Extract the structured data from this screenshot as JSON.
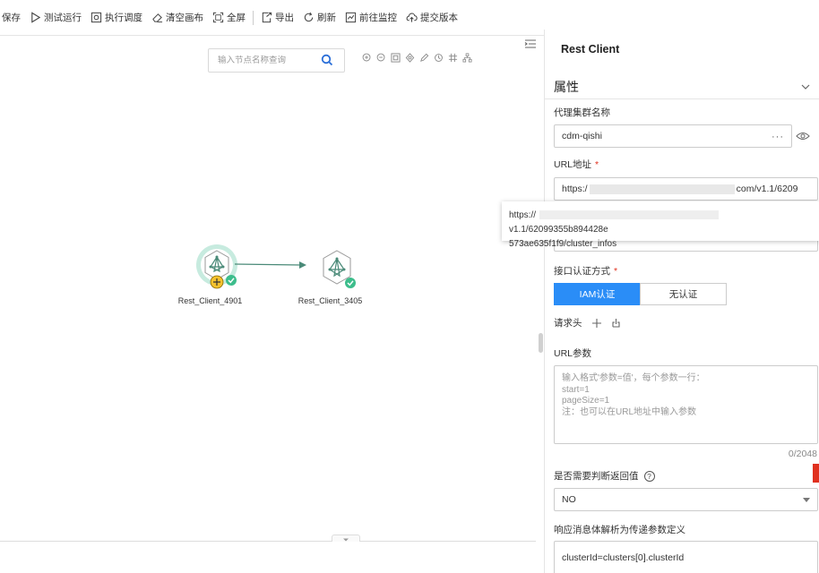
{
  "toolbar": {
    "items": [
      {
        "label": "保存",
        "icon": "save-icon"
      },
      {
        "label": "测试运行",
        "icon": "play-icon"
      },
      {
        "label": "执行调度",
        "icon": "schedule-icon"
      },
      {
        "label": "清空画布",
        "icon": "eraser-icon"
      },
      {
        "label": "全屏",
        "icon": "fullscreen-icon"
      },
      {
        "label": "导出",
        "icon": "export-icon"
      },
      {
        "label": "刷新",
        "icon": "refresh-icon"
      },
      {
        "label": "前往监控",
        "icon": "monitor-icon"
      },
      {
        "label": "提交版本",
        "icon": "upload-cloud-icon"
      }
    ]
  },
  "canvas": {
    "search_placeholder": "输入节点名称查询",
    "nodes": [
      {
        "label": "Rest_Client_4901",
        "status": "success"
      },
      {
        "label": "Rest_Client_3405",
        "status": "success"
      }
    ]
  },
  "panel": {
    "title": "Rest Client",
    "section_title": "属性",
    "proxy_label": "代理集群名称",
    "proxy_value": "cdm-qishi",
    "url_label": "URL地址",
    "required_mark": "*",
    "url_prefix": "https:/",
    "url_suffix": "com/v1.1/6209",
    "tooltip_line1_prefix": "https://",
    "tooltip_line1_suffix": "v1.1/62099355b894428e",
    "tooltip_line2": "573ae635f1f9/cluster_infos",
    "auth_label": "接口认证方式",
    "auth_options": [
      "IAM认证",
      "无认证"
    ],
    "headers_label": "请求头",
    "url_params_label": "URL参数",
    "url_params_placeholder": "输入格式'参数=值'，每个参数一行：\nstart=1\npageSize=1\n注：也可以在URL地址中输入参数",
    "counter": "0/2048",
    "check_return_label": "是否需要判断返回值",
    "check_return_value": "NO",
    "response_label": "响应消息体解析为传递参数定义",
    "response_value": "clusterId=clusters[0].clusterId"
  },
  "colors": {
    "accent": "#2a8df7",
    "success": "#3dbd8c",
    "required": "#e0301e"
  }
}
